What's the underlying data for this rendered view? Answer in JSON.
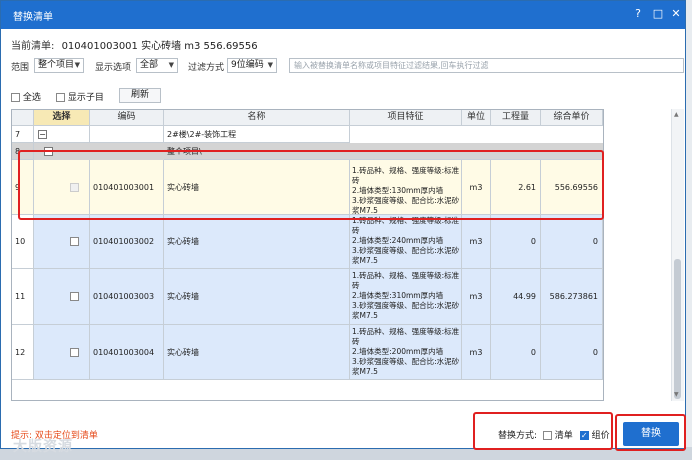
{
  "dialog": {
    "title": "替换清单"
  },
  "titlebar_buttons": {
    "help": "?",
    "maximize": "□",
    "close": "✕"
  },
  "current": {
    "label": "当前清单:",
    "value": "010401003001 实心砖墙 m3 556.69556"
  },
  "filters": {
    "scope_label": "范围",
    "scope_value": "整个项目",
    "display_label": "显示选项",
    "display_value": "全部",
    "filter_label": "过滤方式",
    "filter_value": "9位编码",
    "search_placeholder": "输入被替换清单名称或项目特征过滤结果,回车执行过滤"
  },
  "options": {
    "select_all": "全选",
    "show_children": "显示子目",
    "refresh": "刷新"
  },
  "table": {
    "headers": [
      "选择",
      "编码",
      "名称",
      "项目特征",
      "单位",
      "工程量",
      "综合单价"
    ],
    "group_rows": [
      {
        "num": "7",
        "toggle": "−",
        "name": "2#楼\\2#-装饰工程"
      },
      {
        "num": "8",
        "toggle": "−",
        "name": "整个项目\\"
      }
    ],
    "rows": [
      {
        "num": "9",
        "code": "010401003001",
        "name": "实心砖墙",
        "feature": "1.砖品种、规格、强度等级:标准砖\n2.墙体类型:130mm厚内墙\n3.砂浆强度等级、配合比:水泥砂浆M7.5",
        "unit": "m3",
        "qty": "2.61",
        "price": "556.69556"
      },
      {
        "num": "10",
        "code": "010401003002",
        "name": "实心砖墙",
        "feature": "1.砖品种、规格、强度等级:标准砖\n2.墙体类型:240mm厚内墙\n3.砂浆强度等级、配合比:水泥砂浆M7.5",
        "unit": "m3",
        "qty": "0",
        "price": "0"
      },
      {
        "num": "11",
        "code": "010401003003",
        "name": "实心砖墙",
        "feature": "1.砖品种、规格、强度等级:标准砖\n2.墙体类型:310mm厚内墙\n3.砂浆强度等级、配合比:水泥砂浆M7.5",
        "unit": "m3",
        "qty": "44.99",
        "price": "586.273861"
      },
      {
        "num": "12",
        "code": "010401003004",
        "name": "实心砖墙",
        "feature": "1.砖品种、规格、强度等级:标准砖\n2.墙体类型:200mm厚内墙\n3.砂浆强度等级、配合比:水泥砂浆M7.5",
        "unit": "m3",
        "qty": "0",
        "price": "0"
      }
    ]
  },
  "footer": {
    "hint": "提示: 双击定位到清单",
    "watermark": "大版资源",
    "replace_mode_label": "替换方式:",
    "mode_list": "清单",
    "mode_combo": "组价",
    "replace_button": "替换"
  },
  "colors": {
    "accent": "#1f6fcf",
    "highlight": "#e02020",
    "current_row": "#fffbe6",
    "selected_rows": "#dce9fb",
    "group_row": "#d4d4d4"
  }
}
